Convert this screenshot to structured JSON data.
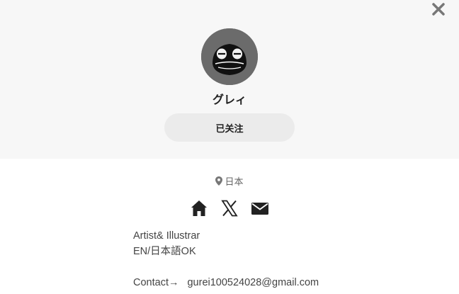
{
  "profile": {
    "name": "グレィ",
    "follow_label": "已关注",
    "location": "日本"
  },
  "bio": {
    "line1": "Artist& Illustrar",
    "line2": "EN/日本語OK",
    "contact_label": "Contact→",
    "contact_email": "gurei100524028@gmail.com"
  },
  "icons": {
    "close": "close-icon",
    "location": "map-pin-icon",
    "home": "home-icon",
    "x": "x-logo-icon",
    "mail": "mail-icon"
  },
  "colors": {
    "panel_bg": "#f7f7f7",
    "button_bg": "#ebebeb",
    "avatar_bg": "#6b6b6b",
    "icon": "#222222"
  }
}
